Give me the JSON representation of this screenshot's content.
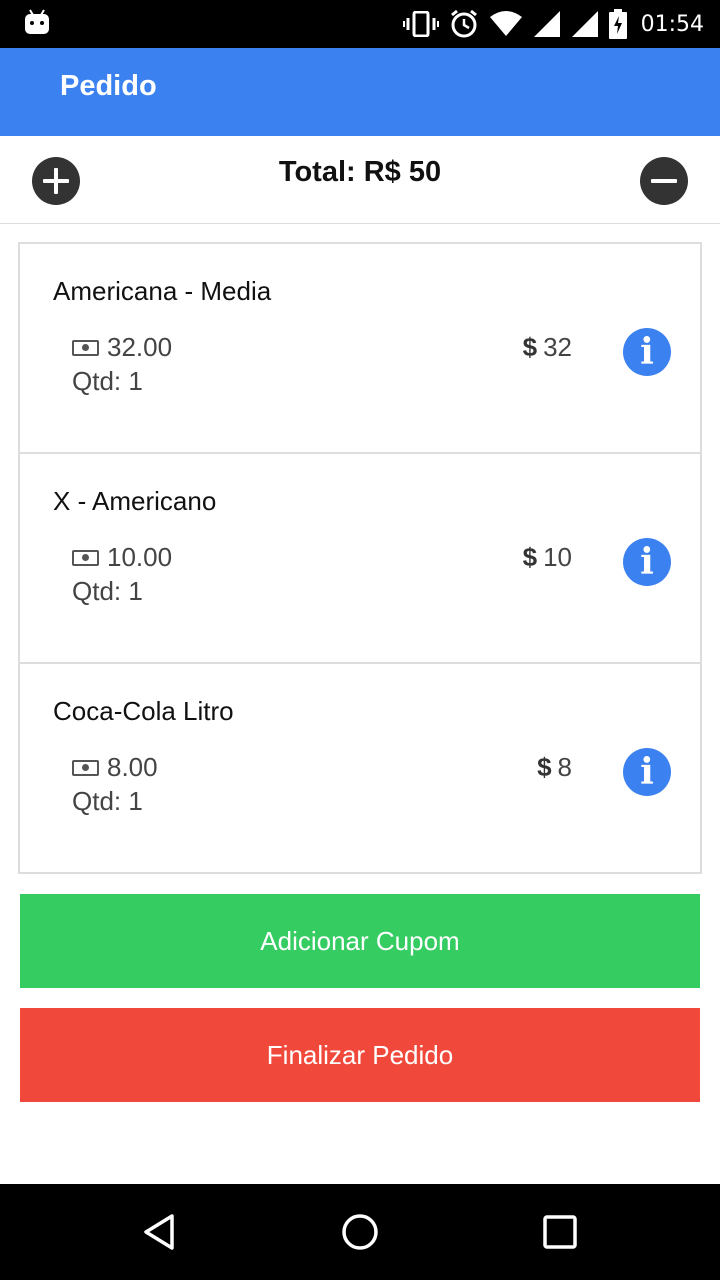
{
  "status_bar": {
    "time": "01:54",
    "icons": [
      "android-icon",
      "vibrate-icon",
      "alarm-icon",
      "wifi-icon",
      "signal-icon",
      "signal-icon",
      "battery-charging-icon"
    ]
  },
  "app_bar": {
    "title": "Pedido"
  },
  "total_row": {
    "label": "Total: R$ 50",
    "add_icon": "plus-circle-icon",
    "remove_icon": "minus-circle-icon"
  },
  "items": [
    {
      "name": "Americana - Media",
      "price": "32.00",
      "qty": "Qtd: 1",
      "subtotal": "32",
      "currency": "$",
      "info_icon": "info-icon"
    },
    {
      "name": "X - Americano",
      "price": "10.00",
      "qty": "Qtd: 1",
      "subtotal": "10",
      "currency": "$",
      "info_icon": "info-icon"
    },
    {
      "name": "Coca-Cola Litro",
      "price": "8.00",
      "qty": "Qtd: 1",
      "subtotal": "8",
      "currency": "$",
      "info_icon": "info-icon"
    }
  ],
  "buttons": {
    "coupon": "Adicionar Cupom",
    "finish": "Finalizar Pedido"
  },
  "colors": {
    "app_bar": "#3b82f0",
    "coupon_button": "#35cc62",
    "finish_button": "#f0493b",
    "info_icon": "#3b82f0"
  },
  "nav_bar": {
    "icons": [
      "back-icon",
      "home-icon",
      "recents-icon"
    ]
  }
}
